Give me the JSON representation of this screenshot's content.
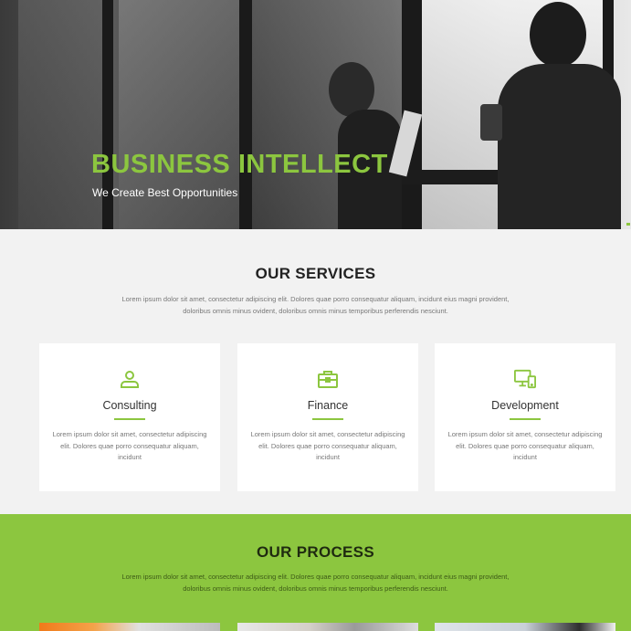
{
  "hero": {
    "title": "BUSINESS INTELLECT",
    "subtitle": "We Create Best Opportunities",
    "accent_color": "#8cc63f"
  },
  "services": {
    "title": "OUR SERVICES",
    "description": "Lorem ipsum dolor sit amet, consectetur adipiscing elit. Dolores quae porro consequatur aliquam, incidunt eius magni provident, doloribus omnis minus ovident, doloribus omnis minus temporibus perferendis nesciunt.",
    "cards": [
      {
        "icon": "user-icon",
        "title": "Consulting",
        "text": "Lorem ipsum dolor sit amet, consectetur adipiscing elit. Dolores quae porro consequatur aliquam, incidunt"
      },
      {
        "icon": "briefcase-icon",
        "title": "Finance",
        "text": "Lorem ipsum dolor sit amet, consectetur adipiscing elit. Dolores quae porro consequatur aliquam, incidunt"
      },
      {
        "icon": "devices-icon",
        "title": "Development",
        "text": "Lorem ipsum dolor sit amet, consectetur adipiscing elit. Dolores quae porro consequatur aliquam, incidunt"
      }
    ]
  },
  "process": {
    "title": "OUR PROCESS",
    "description": "Lorem ipsum dolor sit amet, consectetur adipiscing elit. Dolores quae porro consequatur aliquam, incidunt eius magni provident, doloribus omnis minus ovident, doloribus omnis minus temporibus perferendis nesciunt.",
    "background_color": "#8cc63f"
  }
}
